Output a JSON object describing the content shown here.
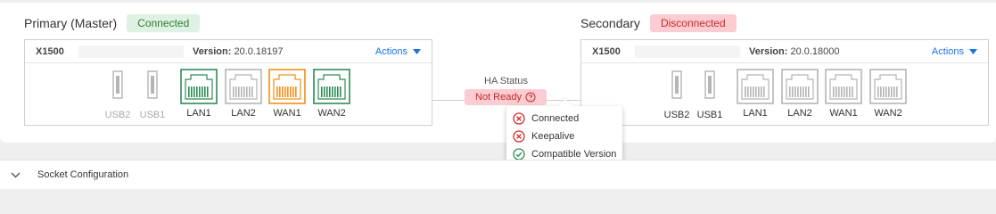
{
  "primary": {
    "title": "Primary (Master)",
    "status": "Connected",
    "model": "X1500",
    "version_label": "Version:",
    "version": "20.0.18197",
    "actions_label": "Actions",
    "ports": [
      {
        "label": "USB2",
        "type": "usb",
        "state": "inactive"
      },
      {
        "label": "USB1",
        "type": "usb",
        "state": "inactive"
      },
      {
        "label": "LAN1",
        "type": "ethernet",
        "state": "connected"
      },
      {
        "label": "LAN2",
        "type": "ethernet",
        "state": "inactive"
      },
      {
        "label": "WAN1",
        "type": "ethernet",
        "state": "warning"
      },
      {
        "label": "WAN2",
        "type": "ethernet",
        "state": "connected"
      }
    ]
  },
  "secondary": {
    "title": "Secondary",
    "status": "Disconnected",
    "model": "X1500",
    "version_label": "Version:",
    "version": "20.0.18000",
    "actions_label": "Actions",
    "ports": [
      {
        "label": "USB2",
        "type": "usb",
        "state": "inactive"
      },
      {
        "label": "USB1",
        "type": "usb",
        "state": "inactive"
      },
      {
        "label": "LAN1",
        "type": "ethernet",
        "state": "inactive"
      },
      {
        "label": "LAN2",
        "type": "ethernet",
        "state": "inactive"
      },
      {
        "label": "WAN1",
        "type": "ethernet",
        "state": "inactive"
      },
      {
        "label": "WAN2",
        "type": "ethernet",
        "state": "inactive"
      }
    ]
  },
  "ha": {
    "label": "HA Status",
    "status": "Not Ready",
    "checks": [
      {
        "label": "Connected",
        "passed": false
      },
      {
        "label": "Keepalive",
        "passed": false
      },
      {
        "label": "Compatible Version",
        "passed": true
      }
    ]
  },
  "socket": {
    "label": "Socket Configuration"
  },
  "colors": {
    "connected": "#2e8b57",
    "warning": "#f0901a",
    "inactive": "#b5b5b5",
    "error": "#d32f2f",
    "link": "#1a73e8"
  }
}
